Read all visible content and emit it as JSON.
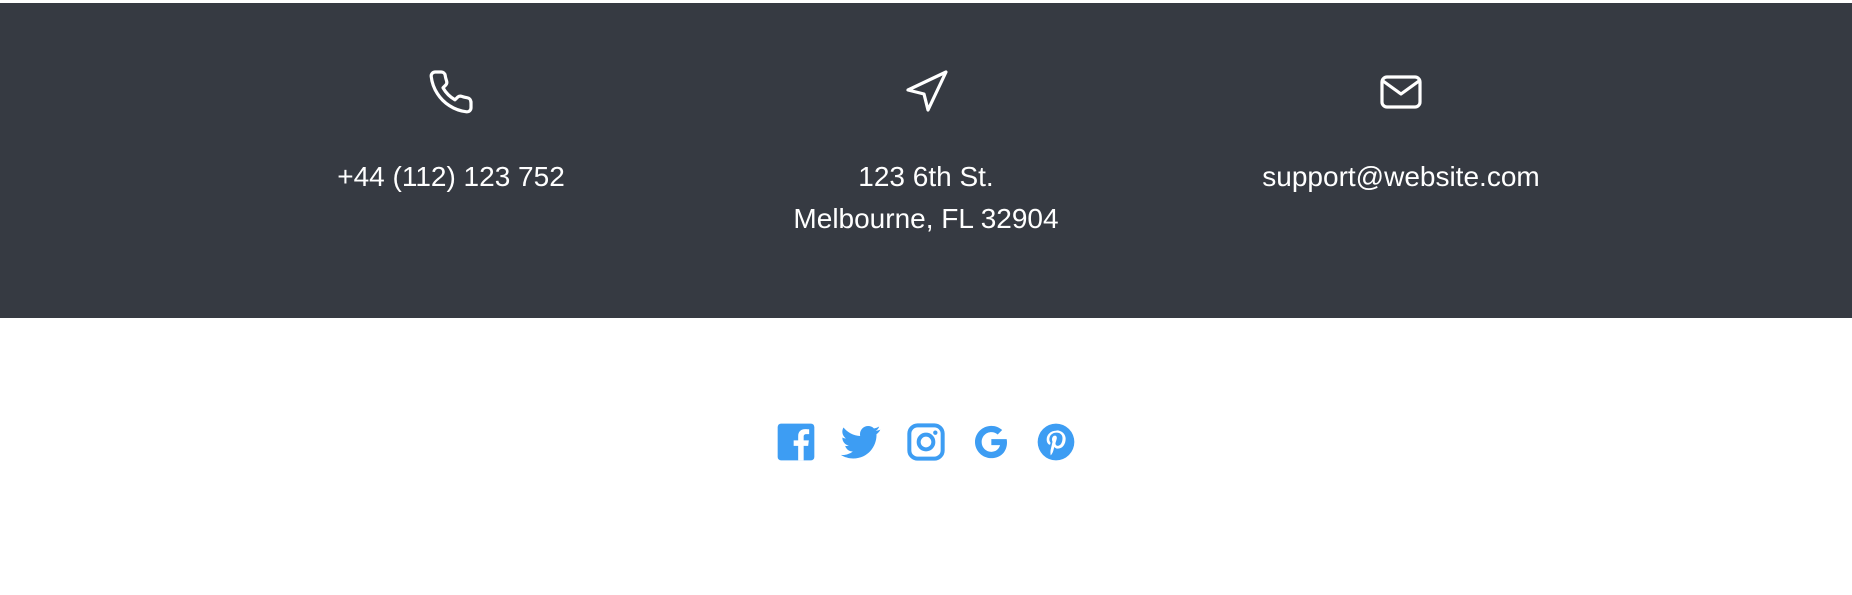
{
  "contact": {
    "phone": {
      "icon": "phone-icon",
      "text": "+44 (112) 123 752"
    },
    "address": {
      "icon": "location-arrow-icon",
      "line1": "123 6th St.",
      "line2": "Melbourne, FL 32904"
    },
    "email": {
      "icon": "envelope-icon",
      "text": "support@website.com"
    }
  },
  "social": {
    "items": [
      {
        "icon": "facebook-icon"
      },
      {
        "icon": "twitter-icon"
      },
      {
        "icon": "instagram-icon"
      },
      {
        "icon": "google-icon"
      },
      {
        "icon": "pinterest-icon"
      }
    ]
  },
  "colors": {
    "band_background": "#363a42",
    "band_text": "#ffffff",
    "social_accent": "#3d9df3",
    "page_background": "#ffffff"
  }
}
